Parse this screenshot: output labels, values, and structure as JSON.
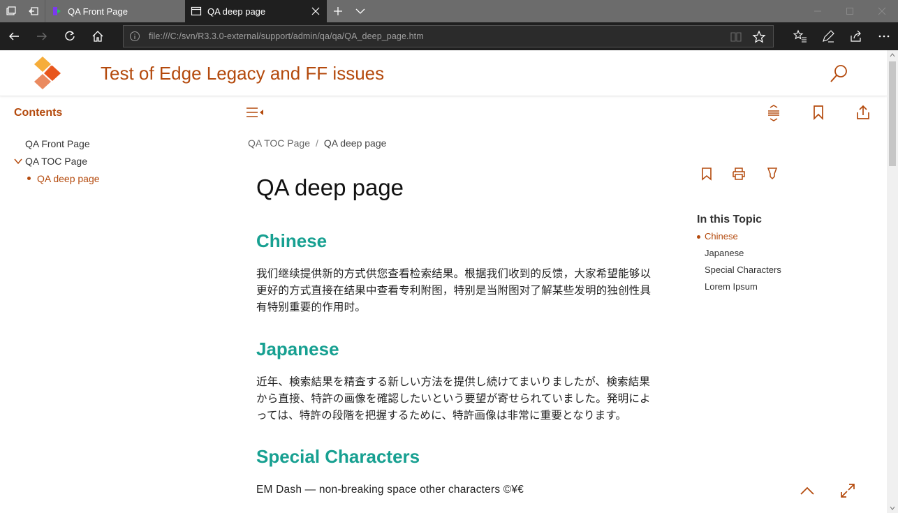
{
  "browser": {
    "tabs": [
      {
        "title": "QA Front Page",
        "active": false
      },
      {
        "title": "QA deep page",
        "active": true
      }
    ],
    "address": "file:///C:/svn/R3.3.0-external/support/admin/qa/qa/QA_deep_page.htm"
  },
  "header": {
    "site_title": "Test of Edge Legacy and FF issues"
  },
  "sidebar": {
    "title": "Contents",
    "items": [
      {
        "label": "QA Front Page"
      },
      {
        "label": "QA TOC Page"
      },
      {
        "label": "QA deep page"
      }
    ]
  },
  "breadcrumb": {
    "parent": "QA TOC Page",
    "separator": "/",
    "current": "QA deep page"
  },
  "article": {
    "title": "QA deep page",
    "sections": [
      {
        "heading": "Chinese",
        "lines": [
          "我们继续提供新的方式供您查看检索结果。根据我们收到的反馈，大家希望能够以",
          "更好的方式直接在结果中查看专利附图，特别是当附图对了解某些发明的独创性具",
          "有特别重要的作用时。"
        ]
      },
      {
        "heading": "Japanese",
        "lines": [
          "近年、検索結果を精査する新しい方法を提供し続けてまいりましたが、検索結果",
          "から直接、特許の画像を確認したいという要望が寄せられていました。発明によ",
          "っては、特許の段階を把握するために、特許画像は非常に重要となります。"
        ]
      },
      {
        "heading": "Special Characters",
        "lines": [
          "EM Dash — non-breaking space  other characters ©¥€"
        ]
      }
    ]
  },
  "in_this_topic": {
    "title": "In this Topic",
    "items": [
      {
        "label": "Chinese"
      },
      {
        "label": "Japanese"
      },
      {
        "label": "Special Characters"
      },
      {
        "label": "Lorem Ipsum"
      }
    ]
  },
  "colors": {
    "accent": "#b44a0d",
    "heading": "#17a091",
    "chrome_dark": "#1f1f1f",
    "chrome_tabs": "#6c6c6c"
  },
  "icons": {
    "logo": "diamond-logo-icon",
    "search": "search-icon",
    "toc_toggle": "menu-collapse-icon",
    "expand_collapse": "expand-collapse-icon",
    "bookmark": "bookmark-icon",
    "share": "share-icon",
    "print": "print-icon",
    "highlight": "highlighter-icon",
    "back_to_top": "chevron-up-icon",
    "fullscreen": "expand-icon"
  }
}
